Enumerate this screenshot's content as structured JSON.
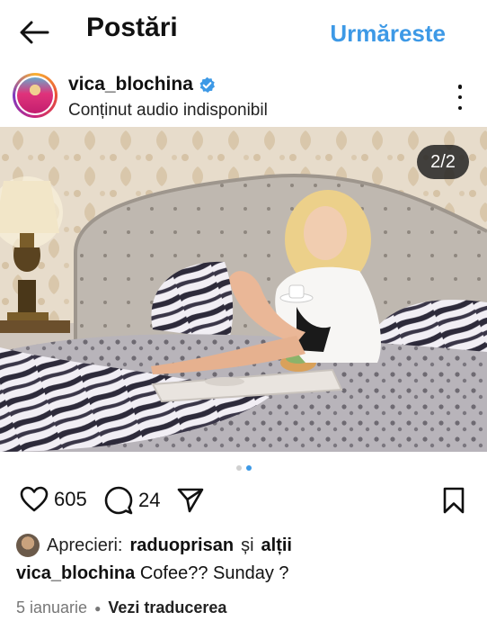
{
  "header": {
    "title": "Postări",
    "follow_label": "Urmăreste"
  },
  "post": {
    "username": "vica_blochina",
    "subtitle": "Conținut audio indisponibil",
    "carousel_counter": "2/2",
    "carousel": {
      "current": 2,
      "total": 2
    },
    "likes_count": "605",
    "comments_count": "24",
    "likes_prefix": "Aprecieri:",
    "likes_user": "raduoprisan",
    "likes_conj": "și",
    "likes_others": "alții",
    "caption_user": "vica_blochina",
    "caption_text": "Cofee?? Sunday ?",
    "date": "5 ianuarie",
    "translate_label": "Vezi traducerea"
  },
  "colors": {
    "accent": "#3d99e6",
    "verified": "#3d99e6",
    "text": "#111111",
    "muted": "#777777"
  },
  "icons": {
    "back": "arrow-left-icon",
    "verified": "verified-badge-icon",
    "more": "more-vertical-icon",
    "like": "heart-icon",
    "comment": "comment-bubble-icon",
    "share": "paper-plane-icon",
    "save": "bookmark-icon"
  }
}
